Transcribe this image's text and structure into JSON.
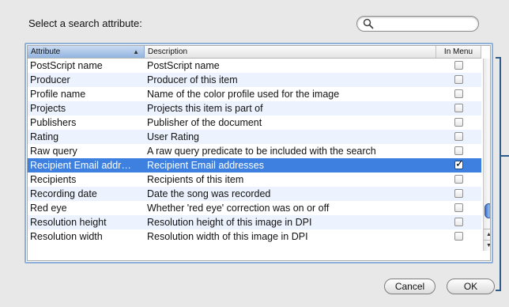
{
  "dialog": {
    "prompt": "Select a search attribute:"
  },
  "search": {
    "value": "",
    "placeholder": "",
    "icon": "magnifier"
  },
  "table": {
    "columns": [
      {
        "label": "Attribute",
        "sorted": "ascending"
      },
      {
        "label": "Description"
      },
      {
        "label": "In Menu"
      }
    ],
    "sort_indicator": "▲",
    "rows": [
      {
        "attribute": "PostScript name",
        "description": "PostScript name",
        "in_menu": false
      },
      {
        "attribute": "Producer",
        "description": "Producer of this item",
        "in_menu": false
      },
      {
        "attribute": "Profile name",
        "description": "Name of the color profile used for the image",
        "in_menu": false
      },
      {
        "attribute": "Projects",
        "description": "Projects this item is part of",
        "in_menu": false
      },
      {
        "attribute": "Publishers",
        "description": "Publisher of the document",
        "in_menu": false
      },
      {
        "attribute": "Rating",
        "description": "User Rating",
        "in_menu": false
      },
      {
        "attribute": "Raw query",
        "description": "A raw query predicate to be included with the search",
        "in_menu": false
      },
      {
        "attribute": "Recipient Email addr…",
        "description": "Recipient Email addresses",
        "in_menu": true,
        "selected": true
      },
      {
        "attribute": "Recipients",
        "description": "Recipients of this item",
        "in_menu": false
      },
      {
        "attribute": "Recording date",
        "description": "Date the song was recorded",
        "in_menu": false
      },
      {
        "attribute": "Red eye",
        "description": "Whether 'red eye' correction was on or off",
        "in_menu": false
      },
      {
        "attribute": "Resolution height",
        "description": "Resolution height of this image in DPI",
        "in_menu": false
      },
      {
        "attribute": "Resolution width",
        "description": "Resolution width of this image in DPI",
        "in_menu": false
      }
    ]
  },
  "scrollbar": {
    "position_fraction": 0.93
  },
  "buttons": {
    "cancel_label": "Cancel",
    "ok_label": "OK"
  },
  "colors": {
    "selection": "#3d80df",
    "alt_row": "#edf3fe",
    "frame": "#8fb0d8",
    "bracket": "#2c5c8c"
  }
}
